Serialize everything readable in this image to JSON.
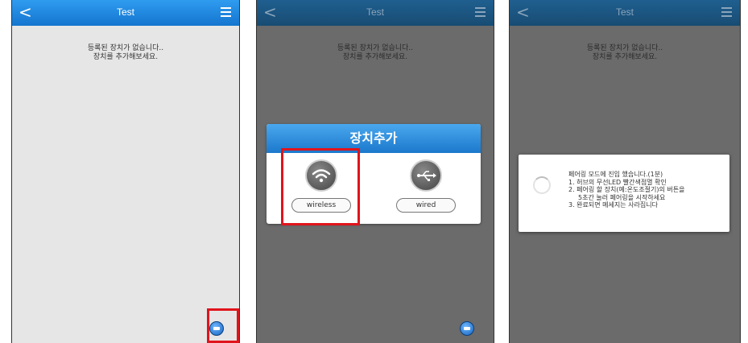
{
  "screens": [
    {
      "header": {
        "back": "<",
        "title": "Test"
      },
      "empty_line1": "등록된 장치가 없습니다..",
      "empty_line2": "장치를 추가해보세요."
    },
    {
      "header": {
        "back": "<",
        "title": "Test"
      },
      "empty_line1": "등록된 장치가 없습니다..",
      "empty_line2": "장치를 추가해보세요.",
      "dialog": {
        "title": "장치추가",
        "options": [
          {
            "label": "wireless",
            "icon": "wifi-icon"
          },
          {
            "label": "wired",
            "icon": "usb-icon"
          }
        ]
      }
    },
    {
      "header": {
        "back": "<",
        "title": "Test"
      },
      "empty_line1": "등록된 장치가 없습니다..",
      "empty_line2": "장치를 추가해보세요.",
      "progress": {
        "lines": [
          "페어링 모드에 진입 했습니다.(1분)",
          "1. 허브의 무선LED 빨간색점멸 확인",
          "2. 페어링 할 장치(예:온도조절기)의 버튼을",
          "5초간 눌러 페어링을 시작하세요",
          "3. 완료되면 메세지는 사라집니다"
        ]
      }
    }
  ],
  "colors": {
    "header": "#1475cf",
    "highlight": "#e0141c",
    "overlay": "#6b6b6b"
  }
}
